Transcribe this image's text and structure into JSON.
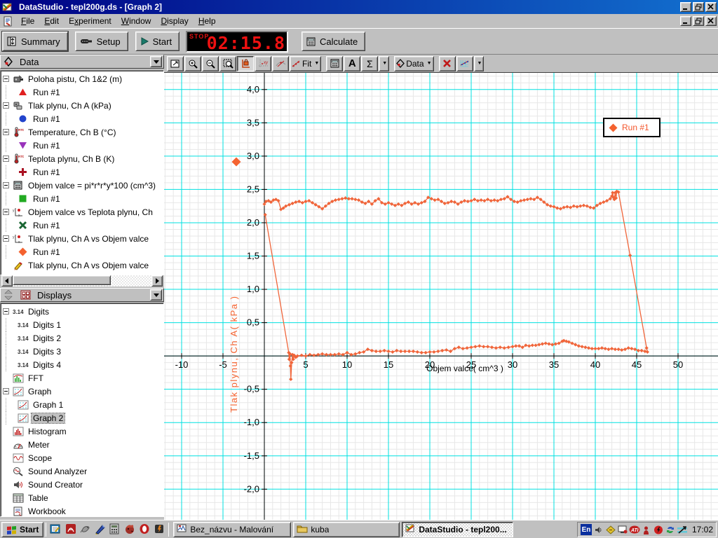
{
  "window": {
    "title": "DataStudio - tepl200g.ds - [Graph 2]"
  },
  "menu": {
    "items": [
      {
        "label": "File",
        "accel": 0
      },
      {
        "label": "Edit",
        "accel": 0
      },
      {
        "label": "Experiment",
        "accel": 1
      },
      {
        "label": "Window",
        "accel": 0
      },
      {
        "label": "Display",
        "accel": 0
      },
      {
        "label": "Help",
        "accel": 0
      }
    ]
  },
  "toolbar": {
    "summary": "Summary",
    "setup": "Setup",
    "start": "Start",
    "calculate": "Calculate",
    "timer": {
      "mode": "STOP",
      "value": "02:15.8"
    }
  },
  "graph_toolbar": {
    "fit_label": "Fit",
    "data_label": "Data",
    "buttons": [
      "scale-to-fit",
      "zoom-in",
      "zoom-out",
      "zoom-select",
      "smart-tool",
      "slope-tool",
      "tangent-tool",
      "fit-menu",
      "calculator",
      "text-annotation",
      "statistics",
      "data-menu",
      "delete",
      "graph-settings"
    ]
  },
  "data_panel": {
    "header": "Data",
    "items": [
      {
        "label": "Poloha pistu, Ch 1&2 (m)",
        "icon": "sensor-icon",
        "runs": [
          {
            "label": "Run #1",
            "marker": "triangle-up",
            "color": "#e02020"
          }
        ]
      },
      {
        "label": "Tlak plynu, Ch A (kPa)",
        "icon": "pressure-sensor-icon",
        "runs": [
          {
            "label": "Run #1",
            "marker": "circle",
            "color": "#2244cc"
          }
        ]
      },
      {
        "label": "Temperature, Ch B (°C)",
        "icon": "thermometer-icon",
        "runs": [
          {
            "label": "Run #1",
            "marker": "triangle-down",
            "color": "#9933bb"
          }
        ]
      },
      {
        "label": "Teplota plynu, Ch B (K)",
        "icon": "thermometer-icon",
        "runs": [
          {
            "label": "Run #1",
            "marker": "plus",
            "color": "#aa1122"
          }
        ]
      },
      {
        "label": "Objem valce = pi*r*r*y*100 (cm^3)",
        "icon": "calculator-icon",
        "runs": [
          {
            "label": "Run #1",
            "marker": "square",
            "color": "#22aa22"
          }
        ]
      },
      {
        "label": "Objem valce vs Teplota plynu, Ch",
        "icon": "xy-graph-icon",
        "runs": [
          {
            "label": "Run #1",
            "marker": "x",
            "color": "#1a6633"
          }
        ]
      },
      {
        "label": "Tlak plynu, Ch A vs Objem valce",
        "icon": "xy-graph-icon",
        "runs": [
          {
            "label": "Run #1",
            "marker": "diamond",
            "color": "#f4622f"
          }
        ]
      },
      {
        "label": "Tlak plynu, Ch A vs Objem valce",
        "icon": "pencil-icon",
        "runs": []
      }
    ]
  },
  "displays_panel": {
    "header": "Displays",
    "items": [
      {
        "label": "Digits",
        "icon": "digits-icon",
        "expanded": true,
        "children": [
          {
            "label": "Digits 1"
          },
          {
            "label": "Digits 2"
          },
          {
            "label": "Digits 3"
          },
          {
            "label": "Digits 4"
          }
        ]
      },
      {
        "label": "FFT",
        "icon": "fft-icon"
      },
      {
        "label": "Graph",
        "icon": "graph-display-icon",
        "expanded": true,
        "children": [
          {
            "label": "Graph 1"
          },
          {
            "label": "Graph 2",
            "selected": true
          }
        ]
      },
      {
        "label": "Histogram",
        "icon": "histogram-icon"
      },
      {
        "label": "Meter",
        "icon": "meter-icon"
      },
      {
        "label": "Scope",
        "icon": "scope-icon"
      },
      {
        "label": "Sound Analyzer",
        "icon": "sound-analyzer-icon"
      },
      {
        "label": "Sound Creator",
        "icon": "sound-creator-icon"
      },
      {
        "label": "Table",
        "icon": "table-icon"
      },
      {
        "label": "Workbook",
        "icon": "workbook-icon"
      }
    ]
  },
  "taskbar": {
    "start_label": "Start",
    "quick_launch": [
      "notes",
      "acrobat",
      "bird",
      "pen",
      "calculator",
      "dragon",
      "opera",
      "winamp"
    ],
    "tasks": [
      {
        "label": "Bez_názvu - Malování",
        "icon": "paint",
        "active": false
      },
      {
        "label": "kuba",
        "icon": "folder",
        "active": false
      },
      {
        "label": "DataStudio - tepl200...",
        "icon": "datastudio",
        "active": true
      }
    ],
    "tray": {
      "keyboard_layout": "En",
      "icons": [
        "volume",
        "scheduler",
        "display-settings",
        "ati",
        "guard",
        "powerstrip",
        "sync",
        "network"
      ],
      "time": "17:02"
    }
  },
  "chart_data": {
    "type": "scatter",
    "title": "",
    "xlabel": "Objem valce( cm^3 )",
    "ylabel": "Tlak plynu, Ch A( kPa )",
    "legend_label": "Run #1",
    "series_name": "Run #1",
    "series_color": "#f0653a",
    "grid_major_color": "#00e0e0",
    "grid_minor_color": "#e7e7e7",
    "xlim": [
      -12.12,
      54.83
    ],
    "ylim": [
      -2.47,
      4.25
    ],
    "x_major": 5,
    "x_minor": 1,
    "y_major": 0.5,
    "y_minor": 0.1,
    "x_ticks": [
      [
        -10,
        "-10"
      ],
      [
        -5,
        "-5"
      ],
      [
        5,
        "5"
      ],
      [
        10,
        "10"
      ],
      [
        15,
        "15"
      ],
      [
        20,
        "20"
      ],
      [
        25,
        "25"
      ],
      [
        30,
        "30"
      ],
      [
        35,
        "35"
      ],
      [
        40,
        "40"
      ],
      [
        45,
        "45"
      ],
      [
        50,
        "50"
      ]
    ],
    "y_ticks": [
      [
        4,
        "4,0"
      ],
      [
        3.5,
        "3,5"
      ],
      [
        3,
        "3,0"
      ],
      [
        2.5,
        "2,5"
      ],
      [
        2,
        "2,0"
      ],
      [
        1.5,
        "1,5"
      ],
      [
        1,
        "1,0"
      ],
      [
        0.5,
        "0,5"
      ],
      [
        -0.5,
        "-0,5"
      ],
      [
        -1,
        "-1,0"
      ],
      [
        -1.5,
        "-1,5"
      ],
      [
        -2,
        "-2,0"
      ]
    ],
    "points": [
      [
        0,
        2.28
      ],
      [
        0.2,
        2.32
      ],
      [
        0.5,
        2.33
      ],
      [
        0.8,
        2.31
      ],
      [
        1.1,
        2.34
      ],
      [
        1.4,
        2.35
      ],
      [
        1.7,
        2.33
      ],
      [
        2,
        2.2
      ],
      [
        2.3,
        2.22
      ],
      [
        2.6,
        2.25
      ],
      [
        3,
        2.27
      ],
      [
        3.4,
        2.29
      ],
      [
        3.8,
        2.31
      ],
      [
        4.2,
        2.32
      ],
      [
        4.6,
        2.3
      ],
      [
        5,
        2.32
      ],
      [
        5.4,
        2.33
      ],
      [
        5.8,
        2.3
      ],
      [
        6.2,
        2.27
      ],
      [
        6.6,
        2.24
      ],
      [
        7,
        2.21
      ],
      [
        7.4,
        2.25
      ],
      [
        7.8,
        2.29
      ],
      [
        8.2,
        2.32
      ],
      [
        8.6,
        2.34
      ],
      [
        9,
        2.35
      ],
      [
        9.4,
        2.36
      ],
      [
        9.8,
        2.37
      ],
      [
        10.2,
        2.36
      ],
      [
        10.6,
        2.36
      ],
      [
        11,
        2.35
      ],
      [
        11.4,
        2.34
      ],
      [
        11.8,
        2.31
      ],
      [
        12.2,
        2.29
      ],
      [
        12.6,
        2.32
      ],
      [
        13,
        2.28
      ],
      [
        13.4,
        2.33
      ],
      [
        13.8,
        2.36
      ],
      [
        14.2,
        2.3
      ],
      [
        14.6,
        2.28
      ],
      [
        15,
        2.3
      ],
      [
        15.4,
        2.28
      ],
      [
        15.8,
        2.26
      ],
      [
        16.2,
        2.28
      ],
      [
        16.6,
        2.26
      ],
      [
        17,
        2.29
      ],
      [
        17.4,
        2.31
      ],
      [
        17.8,
        2.28
      ],
      [
        18.2,
        2.3
      ],
      [
        18.6,
        2.28
      ],
      [
        19,
        2.3
      ],
      [
        19.4,
        2.32
      ],
      [
        19.8,
        2.38
      ],
      [
        20.2,
        2.36
      ],
      [
        20.6,
        2.34
      ],
      [
        21,
        2.35
      ],
      [
        21.4,
        2.32
      ],
      [
        21.8,
        2.29
      ],
      [
        22.2,
        2.3
      ],
      [
        22.6,
        2.32
      ],
      [
        23,
        2.31
      ],
      [
        23.4,
        2.28
      ],
      [
        23.8,
        2.31
      ],
      [
        24.2,
        2.33
      ],
      [
        24.6,
        2.32
      ],
      [
        25,
        2.33
      ],
      [
        25.4,
        2.35
      ],
      [
        25.8,
        2.33
      ],
      [
        26.2,
        2.34
      ],
      [
        26.6,
        2.33
      ],
      [
        27,
        2.35
      ],
      [
        27.4,
        2.33
      ],
      [
        27.8,
        2.34
      ],
      [
        28.2,
        2.33
      ],
      [
        28.6,
        2.35
      ],
      [
        29,
        2.36
      ],
      [
        29.4,
        2.39
      ],
      [
        29.8,
        2.35
      ],
      [
        30.2,
        2.32
      ],
      [
        30.6,
        2.31
      ],
      [
        31,
        2.33
      ],
      [
        31.4,
        2.34
      ],
      [
        31.8,
        2.35
      ],
      [
        32.2,
        2.36
      ],
      [
        32.6,
        2.35
      ],
      [
        33,
        2.38
      ],
      [
        33.4,
        2.35
      ],
      [
        33.8,
        2.31
      ],
      [
        34.2,
        2.27
      ],
      [
        34.6,
        2.25
      ],
      [
        35,
        2.24
      ],
      [
        35.4,
        2.22
      ],
      [
        35.8,
        2.21
      ],
      [
        36.2,
        2.23
      ],
      [
        36.6,
        2.24
      ],
      [
        37,
        2.23
      ],
      [
        37.4,
        2.25
      ],
      [
        37.8,
        2.24
      ],
      [
        38.2,
        2.25
      ],
      [
        38.6,
        2.26
      ],
      [
        39,
        2.25
      ],
      [
        39.4,
        2.23
      ],
      [
        39.8,
        2.22
      ],
      [
        40.2,
        2.26
      ],
      [
        40.6,
        2.29
      ],
      [
        41,
        2.31
      ],
      [
        41.4,
        2.33
      ],
      [
        41.8,
        2.36
      ],
      [
        42,
        2.4
      ],
      [
        42.1,
        2.45
      ],
      [
        42.2,
        2.38
      ],
      [
        42.3,
        2.35
      ],
      [
        42.4,
        2.45
      ],
      [
        42.5,
        2.37
      ],
      [
        42.6,
        2.47
      ],
      [
        42.8,
        2.46
      ],
      [
        44.2,
        1.51
      ],
      [
        46.2,
        0.12
      ],
      [
        46.3,
        0.06
      ],
      [
        46,
        0.07
      ],
      [
        45.6,
        0.08
      ],
      [
        45.2,
        0.08
      ],
      [
        44.8,
        0.1
      ],
      [
        44.4,
        0.11
      ],
      [
        44,
        0.12
      ],
      [
        43.6,
        0.1
      ],
      [
        43.2,
        0.09
      ],
      [
        42.8,
        0.1
      ],
      [
        42.4,
        0.1
      ],
      [
        42,
        0.11
      ],
      [
        41.6,
        0.1
      ],
      [
        41.2,
        0.11
      ],
      [
        40.8,
        0.12
      ],
      [
        40.4,
        0.11
      ],
      [
        40,
        0.11
      ],
      [
        39.6,
        0.11
      ],
      [
        39.2,
        0.12
      ],
      [
        38.8,
        0.13
      ],
      [
        38.4,
        0.14
      ],
      [
        38,
        0.15
      ],
      [
        37.6,
        0.17
      ],
      [
        37.2,
        0.19
      ],
      [
        36.8,
        0.21
      ],
      [
        36.5,
        0.22
      ],
      [
        36.2,
        0.23
      ],
      [
        36,
        0.22
      ],
      [
        35.6,
        0.19
      ],
      [
        35.2,
        0.18
      ],
      [
        34.8,
        0.17
      ],
      [
        34.4,
        0.18
      ],
      [
        34,
        0.19
      ],
      [
        33.6,
        0.18
      ],
      [
        33.2,
        0.17
      ],
      [
        32.8,
        0.16
      ],
      [
        32.4,
        0.16
      ],
      [
        32,
        0.15
      ],
      [
        31.6,
        0.16
      ],
      [
        31.2,
        0.13
      ],
      [
        30.8,
        0.15
      ],
      [
        30.4,
        0.15
      ],
      [
        30,
        0.14
      ],
      [
        29.5,
        0.13
      ],
      [
        29,
        0.12
      ],
      [
        28.5,
        0.13
      ],
      [
        28,
        0.12
      ],
      [
        27.5,
        0.13
      ],
      [
        27,
        0.14
      ],
      [
        26.5,
        0.14
      ],
      [
        26,
        0.15
      ],
      [
        25.5,
        0.14
      ],
      [
        25,
        0.13
      ],
      [
        24.5,
        0.12
      ],
      [
        24,
        0.11
      ],
      [
        23.5,
        0.13
      ],
      [
        23,
        0.11
      ],
      [
        22.5,
        0.07
      ],
      [
        22,
        0.09
      ],
      [
        21.5,
        0.08
      ],
      [
        21,
        0.07
      ],
      [
        20.5,
        0.06
      ],
      [
        20,
        0.06
      ],
      [
        19.5,
        0.05
      ],
      [
        19,
        0.05
      ],
      [
        18.5,
        0.06
      ],
      [
        18,
        0.07
      ],
      [
        17.5,
        0.07
      ],
      [
        17,
        0.07
      ],
      [
        16.5,
        0.07
      ],
      [
        16,
        0.08
      ],
      [
        15.5,
        0.06
      ],
      [
        15,
        0.07
      ],
      [
        14.5,
        0.08
      ],
      [
        14,
        0.07
      ],
      [
        13.5,
        0.07
      ],
      [
        13,
        0.08
      ],
      [
        12.5,
        0.1
      ],
      [
        12,
        0.06
      ],
      [
        11.5,
        0.05
      ],
      [
        11,
        0.03
      ],
      [
        10.5,
        0.02
      ],
      [
        10,
        0.05
      ],
      [
        9.5,
        0.02
      ],
      [
        9,
        0.03
      ],
      [
        8.5,
        0.02
      ],
      [
        8,
        0.02
      ],
      [
        7.5,
        0.02
      ],
      [
        7,
        0.03
      ],
      [
        6.5,
        0.02
      ],
      [
        6,
        0.01
      ],
      [
        5.5,
        0.02
      ],
      [
        5,
        0
      ],
      [
        4.5,
        0.01
      ],
      [
        4,
        0
      ],
      [
        3.8,
        -0.02
      ],
      [
        3.6,
        0.01
      ],
      [
        3.5,
        -0.05
      ],
      [
        3.4,
        0.02
      ],
      [
        3.3,
        -0.1
      ],
      [
        3.2,
        -0.35
      ],
      [
        3.15,
        -0.15
      ],
      [
        3.1,
        0.03
      ],
      [
        3,
        -0.05
      ],
      [
        2.95,
        0.05
      ],
      [
        0.1,
        2.12
      ]
    ]
  }
}
